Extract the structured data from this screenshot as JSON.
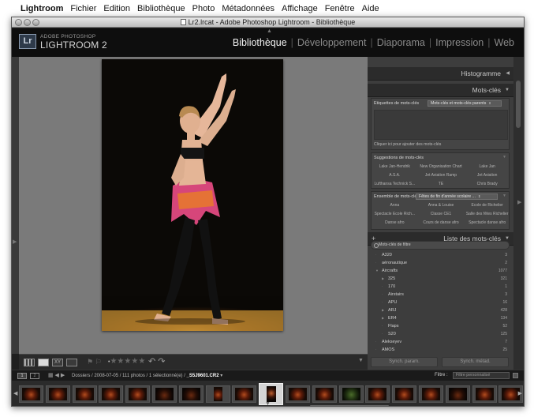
{
  "menubar": {
    "app": "Lightroom",
    "items": [
      "Fichier",
      "Edition",
      "Bibliothèque",
      "Photo",
      "Métadonnées",
      "Affichage",
      "Fenêtre",
      "Aide"
    ]
  },
  "window": {
    "title": "Lr2.lrcat - Adobe Photoshop Lightroom - Bibliothèque"
  },
  "identity": {
    "logo": "Lr",
    "small": "ADOBE PHOTOSHOP",
    "big": "LIGHTROOM 2"
  },
  "modules": {
    "bibliotheque": "Bibliothèque",
    "developpement": "Développement",
    "diaporama": "Diaporama",
    "impression": "Impression",
    "web": "Web"
  },
  "panels": {
    "histogram": "Histogramme",
    "keywording": "Mots-clés",
    "tags": {
      "label": "Etiquettes de mots-clés",
      "dropdown": "Mots-clés et mots-clés parents",
      "hint": "Cliquer ici pour ajouter des mots-clés"
    },
    "suggestions": {
      "label": "Suggestions de mots-clés",
      "items": [
        "Lake Jan-Hendrik",
        "New Organisation Chart",
        "Lake Jan",
        "A.S.A.",
        "Jet Aviation Ramp",
        "Jet Aviation",
        "Lufthansa Technick S...",
        "TE",
        "Chris Brady"
      ]
    },
    "keyword_set": {
      "label": "Ensemble de mots-clés",
      "dropdown": "Fêtes de fin d'année scolaire ...",
      "items": [
        "Anna",
        "Anna & Louise",
        "Ecole de Richelier",
        "Spectacle Ecole Rich...",
        "Classe CE1",
        "Salle des fêtes Richelier",
        "Danse afro",
        "Cours de danse afro",
        "Spectacle danse afro"
      ]
    },
    "keyword_list": {
      "title": "Liste des mots-clés",
      "plus": "+",
      "filter": "Mots-clés de filtre",
      "rows": [
        {
          "name": "A320",
          "count": "3"
        },
        {
          "name": "aéronautique",
          "count": "2"
        },
        {
          "name": "Aircrafts",
          "count": "1077"
        },
        {
          "name": "325",
          "count": "321"
        },
        {
          "name": "170",
          "count": "1"
        },
        {
          "name": "Airstairs",
          "count": "3"
        },
        {
          "name": "APU",
          "count": "16"
        },
        {
          "name": "ARJ",
          "count": "428"
        },
        {
          "name": "ER4",
          "count": "134"
        },
        {
          "name": "Flaps",
          "count": "52"
        },
        {
          "name": "S20",
          "count": "125"
        },
        {
          "name": "Alekseyev",
          "count": "7"
        },
        {
          "name": "AMOS",
          "count": "25"
        }
      ]
    },
    "buttons": {
      "sync_settings": "Synch. param.",
      "sync_metadata": "Synch. métad."
    }
  },
  "toolbar": {
    "stars": "★★★★★"
  },
  "filmbar": {
    "box1": "1",
    "box2": "2",
    "path": "Dossiers / 2008-07-05 / 111 photos / 1 sélectionné(e) /",
    "filename": "_S5J9601.CR2",
    "filter_label": "Filtre :",
    "filter_value": "Filtre personnalisé"
  },
  "filmstrip": {
    "thumb_count": 19
  }
}
